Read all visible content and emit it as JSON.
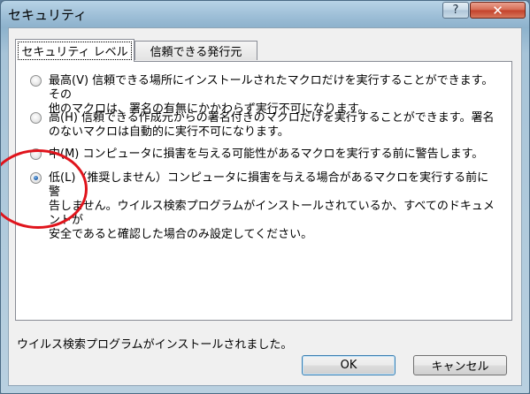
{
  "window": {
    "title": "セキュリティ",
    "help_label": "?",
    "close_label": "✕"
  },
  "tabs": [
    {
      "label": "セキュリティ レベル",
      "active": true
    },
    {
      "label": "信頼できる発行元",
      "active": false
    }
  ],
  "options": [
    {
      "line1": "最高(V)  信頼できる場所にインストールされたマクロだけを実行することができます。その",
      "line2": "他のマクロは、署名の有無にかかわらず実行不可になります。",
      "line3": "",
      "checked": false
    },
    {
      "line1": "高(H)  信頼できる作成元からの署名付きのマクロだけを実行することができます。署名",
      "line2": "のないマクロは自動的に実行不可になります。",
      "line3": "",
      "checked": false
    },
    {
      "line1": "中(M)  コンピュータに損害を与える可能性があるマクロを実行する前に警告します。",
      "line2": "",
      "line3": "",
      "checked": false
    },
    {
      "line1": "低(L)（推奨しません）コンピュータに損害を与える場合があるマクロを実行する前に警",
      "line2": "告しません。ウイルス検索プログラムがインストールされているか、すべてのドキュメントが",
      "line3": "安全であると確認した場合のみ設定してください。",
      "checked": true
    }
  ],
  "status": "ウイルス検索プログラムがインストールされました。",
  "buttons": {
    "ok": "OK",
    "cancel": "キャンセル"
  },
  "colors": {
    "annotation": "#e0141c",
    "close_button": "#c2402a"
  }
}
